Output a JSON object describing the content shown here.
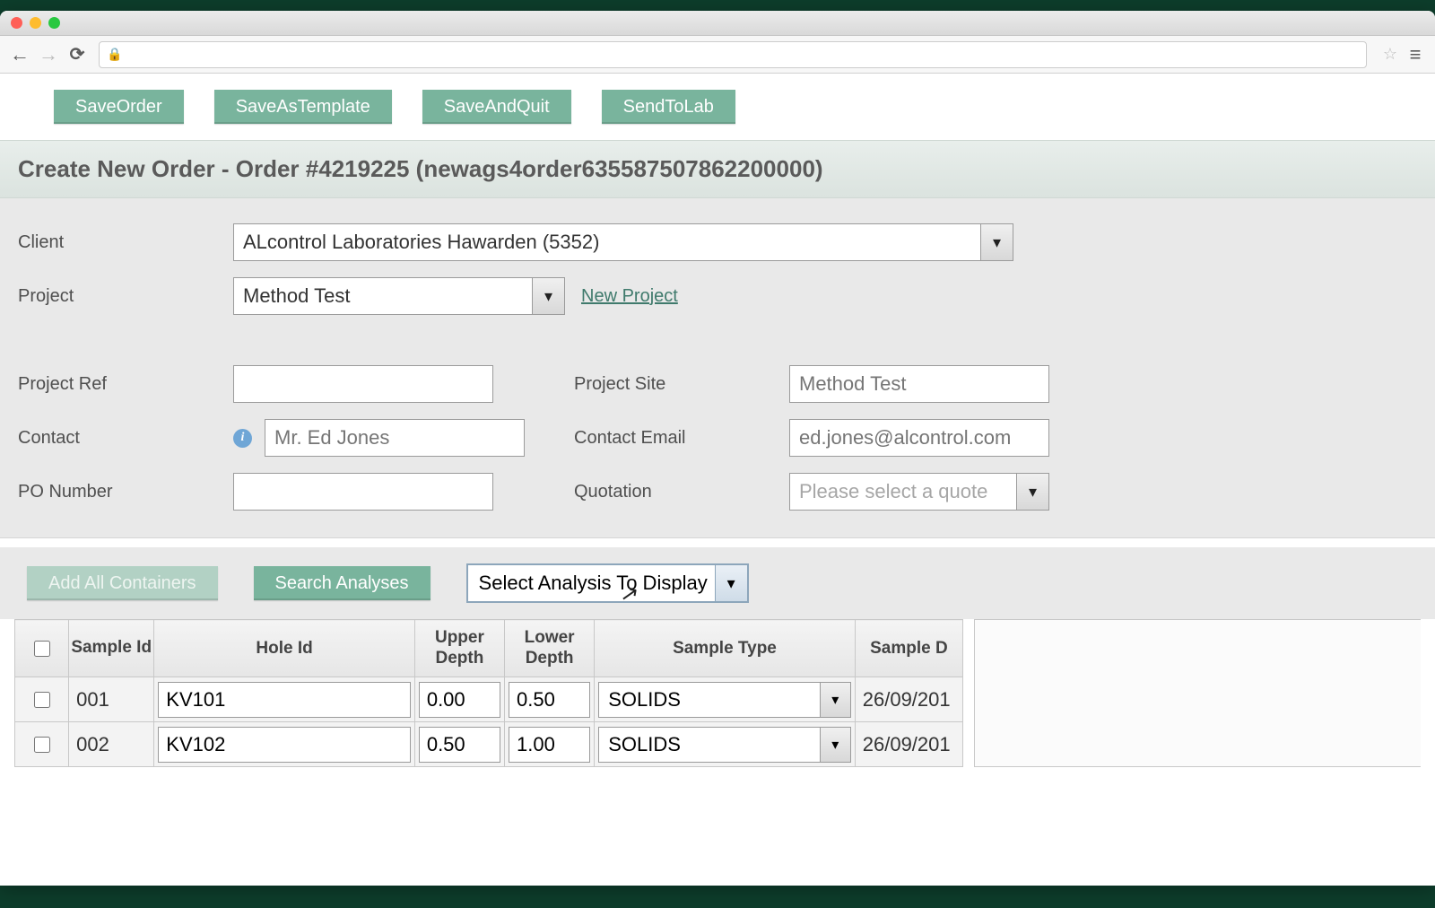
{
  "toolbar": {
    "save_order": "SaveOrder",
    "save_as_template": "SaveAsTemplate",
    "save_and_quit": "SaveAndQuit",
    "send_to_lab": "SendToLab"
  },
  "page_title": "Create New Order - Order #4219225 (newags4order635587507862200000)",
  "form": {
    "labels": {
      "client": "Client",
      "project": "Project",
      "project_ref": "Project Ref",
      "contact": "Contact",
      "po_number": "PO Number",
      "project_site": "Project Site",
      "contact_email": "Contact Email",
      "quotation": "Quotation"
    },
    "client_value": "ALcontrol Laboratories Hawarden (5352)",
    "project_value": "Method Test",
    "new_project_link": "New Project",
    "project_ref_value": "",
    "contact_placeholder": "Mr. Ed Jones",
    "po_number_value": "",
    "project_site_placeholder": "Method Test",
    "contact_email_placeholder": "ed.jones@alcontrol.com",
    "quotation_placeholder": "Please select a quote"
  },
  "actions": {
    "add_all_containers": "Add All Containers",
    "search_analyses": "Search Analyses",
    "select_analysis": "Select Analysis To Display"
  },
  "table": {
    "headers": {
      "sample_id": "Sample Id",
      "hole_id": "Hole Id",
      "upper_depth": "Upper Depth",
      "lower_depth": "Lower Depth",
      "sample_type": "Sample Type",
      "sample_date": "Sample D"
    },
    "rows": [
      {
        "sample_id": "001",
        "hole_id": "KV101",
        "upper": "0.00",
        "lower": "0.50",
        "type": "SOLIDS",
        "date": "26/09/201"
      },
      {
        "sample_id": "002",
        "hole_id": "KV102",
        "upper": "0.50",
        "lower": "1.00",
        "type": "SOLIDS",
        "date": "26/09/201"
      }
    ]
  }
}
